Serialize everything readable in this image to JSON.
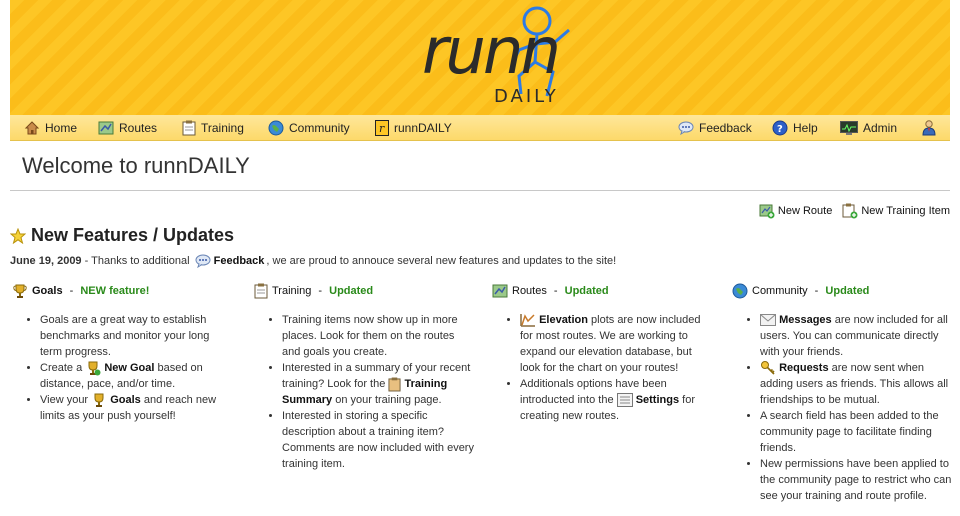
{
  "logo": {
    "word": "runn",
    "sub": "DAILY"
  },
  "nav": {
    "home": "Home",
    "routes": "Routes",
    "training": "Training",
    "community": "Community",
    "runndaily": "runnDAILY",
    "feedback": "Feedback",
    "help": "Help",
    "admin": "Admin"
  },
  "page": {
    "title": "Welcome to runnDAILY"
  },
  "actions": {
    "new_route": "New Route",
    "new_training": "New Training Item"
  },
  "section": {
    "title": "New Features / Updates"
  },
  "intro": {
    "date": "June 19, 2009",
    "before": " - Thanks to additional ",
    "link": "Feedback",
    "after": ", we are proud to annouce several new features and updates to the site!"
  },
  "columns": {
    "goals": {
      "title": "Goals",
      "sep": " - ",
      "status": "NEW feature!",
      "item1": "Goals are a great way to establish benchmarks and monitor your long term progress.",
      "item2_pre": "Create a ",
      "item2_link": "New Goal",
      "item2_post": " based on distance, pace, and/or time.",
      "item3_pre": "View your ",
      "item3_link": "Goals",
      "item3_post": " and reach new limits as your push yourself!"
    },
    "training": {
      "title": "Training",
      "sep": " - ",
      "status": "Updated",
      "item1": "Training items now show up in more places. Look for them on the routes and goals you create.",
      "item2_pre": "Interested in a summary of your recent training? Look for the ",
      "item2_link": "Training Summary",
      "item2_post": " on your training page.",
      "item3": "Interested in storing a specific description about a training item? Comments are now included with every training item."
    },
    "routes": {
      "title": "Routes",
      "sep": " - ",
      "status": "Updated",
      "item1_link": "Elevation",
      "item1_post": " plots are now included for most routes. We are working to expand our elevation database, but look for the chart on your routes!",
      "item2_pre": "Additionals options have been introducted into the ",
      "item2_link": "Settings",
      "item2_post": " for creating new routes."
    },
    "community": {
      "title": "Community",
      "sep": " - ",
      "status": "Updated",
      "item1_link": "Messages",
      "item1_post": " are now included for all users. You can communicate directly with your friends.",
      "item2_link": "Requests",
      "item2_post": " are now sent when adding users as friends. This allows all friendships to be mutual.",
      "item3": "A search field has been added to the community page to facilitate finding friends.",
      "item4": "New permissions have been applied to the community page to restrict who can see your training and route profile."
    }
  },
  "colors": {
    "banner": "#fdc625",
    "updated": "#2a8a1a",
    "nav": "#fee79a"
  }
}
